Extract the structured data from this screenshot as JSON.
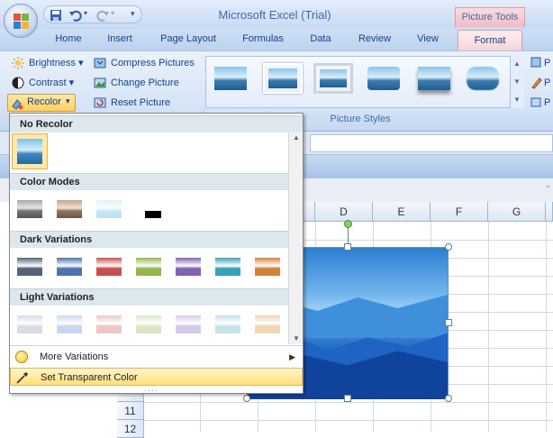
{
  "window": {
    "title": "Microsoft Excel (Trial)",
    "context_tab_group": "Picture Tools"
  },
  "tabs": [
    "Home",
    "Insert",
    "Page Layout",
    "Formulas",
    "Data",
    "Review",
    "View"
  ],
  "active_tab": "Format",
  "adjust_group": {
    "brightness": "Brightness",
    "contrast": "Contrast",
    "recolor": "Recolor",
    "compress": "Compress Pictures",
    "change": "Change Picture",
    "reset": "Reset Picture"
  },
  "picture_styles_label": "Picture Styles",
  "right_buttons": [
    "P",
    "P",
    "P"
  ],
  "recolor_menu": {
    "no_recolor": "No Recolor",
    "color_modes": "Color Modes",
    "dark_variations": "Dark Variations",
    "light_variations": "Light Variations",
    "more_variations": "More Variations",
    "set_transparent": "Set Transparent Color",
    "dark_colors": [
      "#56627a",
      "#4f72b0",
      "#c55050",
      "#93b74b",
      "#8461b0",
      "#3aa0b8",
      "#d1823a"
    ],
    "light_colors": [
      "#d7dbe3",
      "#c9d7ee",
      "#eac8c8",
      "#dbe7c4",
      "#d6cae9",
      "#c3e2ea",
      "#f2d4b7"
    ]
  },
  "columns": [
    "D",
    "E",
    "F",
    "G"
  ],
  "rows": [
    "11",
    "12"
  ]
}
